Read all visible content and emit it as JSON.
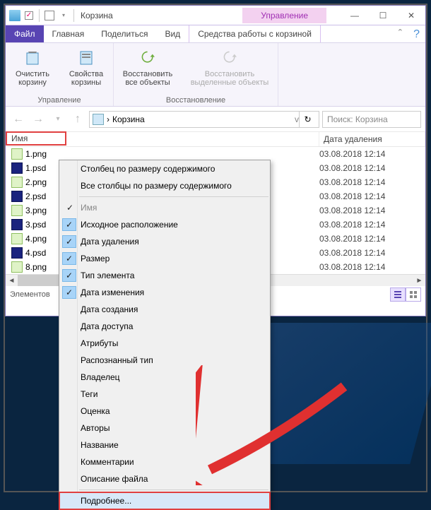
{
  "titlebar": {
    "title": "Корзина",
    "manage_tab": "Управление"
  },
  "tabs": {
    "file": "Файл",
    "home": "Главная",
    "share": "Поделиться",
    "view": "Вид",
    "context": "Средства работы с корзиной"
  },
  "ribbon": {
    "empty": "Очистить корзину",
    "properties": "Свойства корзины",
    "restore_all": "Восстановить все объекты",
    "restore_sel": "Восстановить выделенные объекты",
    "group_manage": "Управление",
    "group_restore": "Восстановление"
  },
  "address": {
    "separator": "›",
    "location": "Корзина",
    "dropdown": "v"
  },
  "search": {
    "placeholder": "Поиск: Корзина"
  },
  "columns": {
    "name": "Имя",
    "deleted_date": "Дата удаления"
  },
  "files": [
    {
      "name": "1.png",
      "type": "png",
      "date": "03.08.2018 12:14"
    },
    {
      "name": "1.psd",
      "type": "psd",
      "date": "03.08.2018 12:14"
    },
    {
      "name": "2.png",
      "type": "png",
      "date": "03.08.2018 12:14"
    },
    {
      "name": "2.psd",
      "type": "psd",
      "date": "03.08.2018 12:14"
    },
    {
      "name": "3.png",
      "type": "png",
      "date": "03.08.2018 12:14"
    },
    {
      "name": "3.psd",
      "type": "psd",
      "date": "03.08.2018 12:14"
    },
    {
      "name": "4.png",
      "type": "png",
      "date": "03.08.2018 12:14"
    },
    {
      "name": "4.psd",
      "type": "psd",
      "date": "03.08.2018 12:14"
    },
    {
      "name": "8.png",
      "type": "png",
      "date": "03.08.2018 12:14"
    }
  ],
  "statusbar": {
    "elements": "Элементов"
  },
  "context_menu": {
    "size_column": "Столбец по размеру содержимого",
    "size_all": "Все столбцы по размеру содержимого",
    "items": [
      {
        "label": "Имя",
        "checked": true,
        "disabled": true
      },
      {
        "label": "Исходное расположение",
        "checked": true
      },
      {
        "label": "Дата удаления",
        "checked": true
      },
      {
        "label": "Размер",
        "checked": true
      },
      {
        "label": "Тип элемента",
        "checked": true
      },
      {
        "label": "Дата изменения",
        "checked": true
      },
      {
        "label": "Дата создания",
        "checked": false
      },
      {
        "label": "Дата доступа",
        "checked": false
      },
      {
        "label": "Атрибуты",
        "checked": false
      },
      {
        "label": "Распознанный тип",
        "checked": false
      },
      {
        "label": "Владелец",
        "checked": false
      },
      {
        "label": "Теги",
        "checked": false
      },
      {
        "label": "Оценка",
        "checked": false
      },
      {
        "label": "Авторы",
        "checked": false
      },
      {
        "label": "Название",
        "checked": false
      },
      {
        "label": "Комментарии",
        "checked": false
      },
      {
        "label": "Описание файла",
        "checked": false
      }
    ],
    "more": "Подробнее..."
  }
}
